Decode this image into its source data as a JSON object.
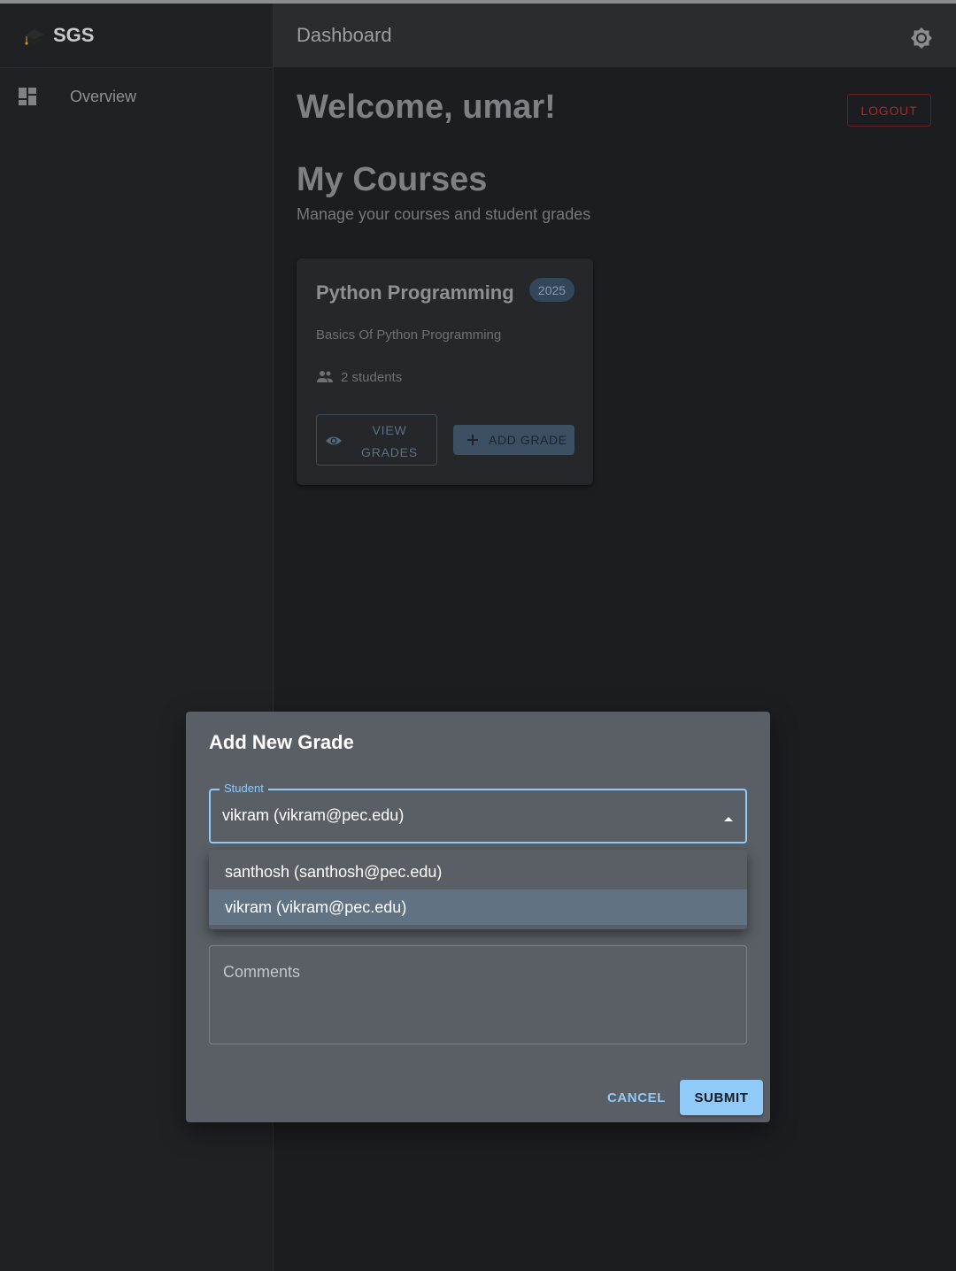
{
  "app": {
    "logo_text": "SGS"
  },
  "sidebar": {
    "items": [
      {
        "label": "Overview",
        "icon": "dashboard-icon"
      }
    ]
  },
  "appbar": {
    "title": "Dashboard",
    "theme_icon": "brightness-icon"
  },
  "main": {
    "welcome": "Welcome, umar!",
    "logout_label": "LOGOUT",
    "section_title": "My Courses",
    "section_subtitle": "Manage your courses and student grades"
  },
  "course_card": {
    "title": "Python Programming",
    "year_chip": "2025",
    "description": "Basics Of Python Programming",
    "students": "2 students",
    "view_grades_label": "VIEW GRADES",
    "add_grade_label": "ADD GRADE"
  },
  "dialog": {
    "title": "Add New Grade",
    "student_field": {
      "label": "Student",
      "value": "vikram (vikram@pec.edu)",
      "options": [
        "santhosh (santhosh@pec.edu)",
        "vikram (vikram@pec.edu)"
      ],
      "selected_index": 1
    },
    "comments_placeholder": "Comments",
    "cancel_label": "CANCEL",
    "submit_label": "SUBMIT"
  },
  "colors": {
    "accent": "#90caf9",
    "logout_red": "#a72a2a",
    "dialog_bg": "#5a5f66",
    "background": "#1b1d20"
  }
}
